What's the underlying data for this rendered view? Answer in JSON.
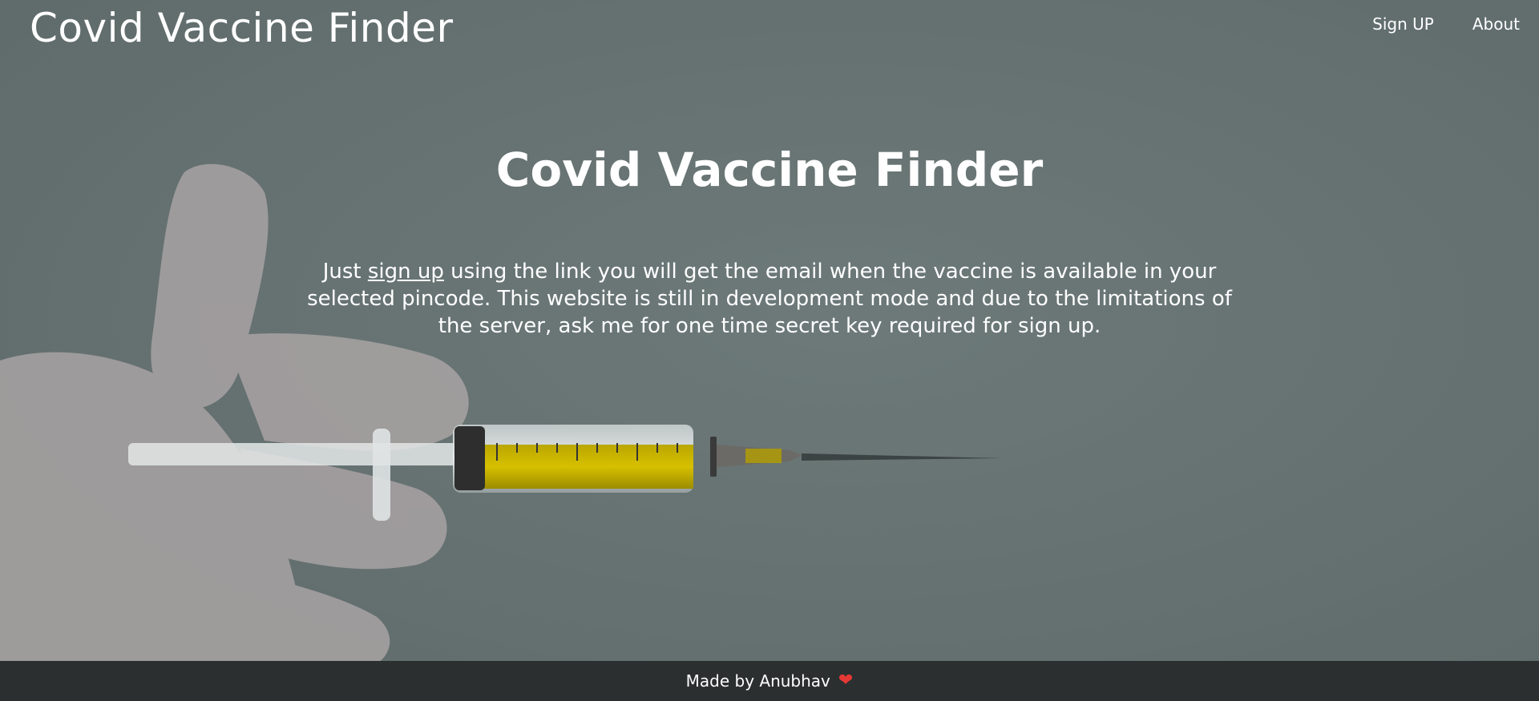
{
  "header": {
    "brand": "Covid Vaccine Finder",
    "nav": [
      {
        "label": "Sign UP"
      },
      {
        "label": "About"
      }
    ]
  },
  "hero": {
    "title": "Covid Vaccine Finder",
    "text_before_link": "Just ",
    "link_label": "sign up",
    "text_after_link": " using the link you will get the email when the vaccine is available in your selected pincode. This website is still in development mode and due to the limitations of the server, ask me for one time secret key required for sign up."
  },
  "footer": {
    "text": "Made by Anubhav",
    "icon": "heart-icon"
  },
  "colors": {
    "background": "#6a7574",
    "footer_bg": "#2b2f30",
    "text": "#ffffff",
    "heart": "#e53935",
    "vaccine_liquid": "#c8b400"
  }
}
